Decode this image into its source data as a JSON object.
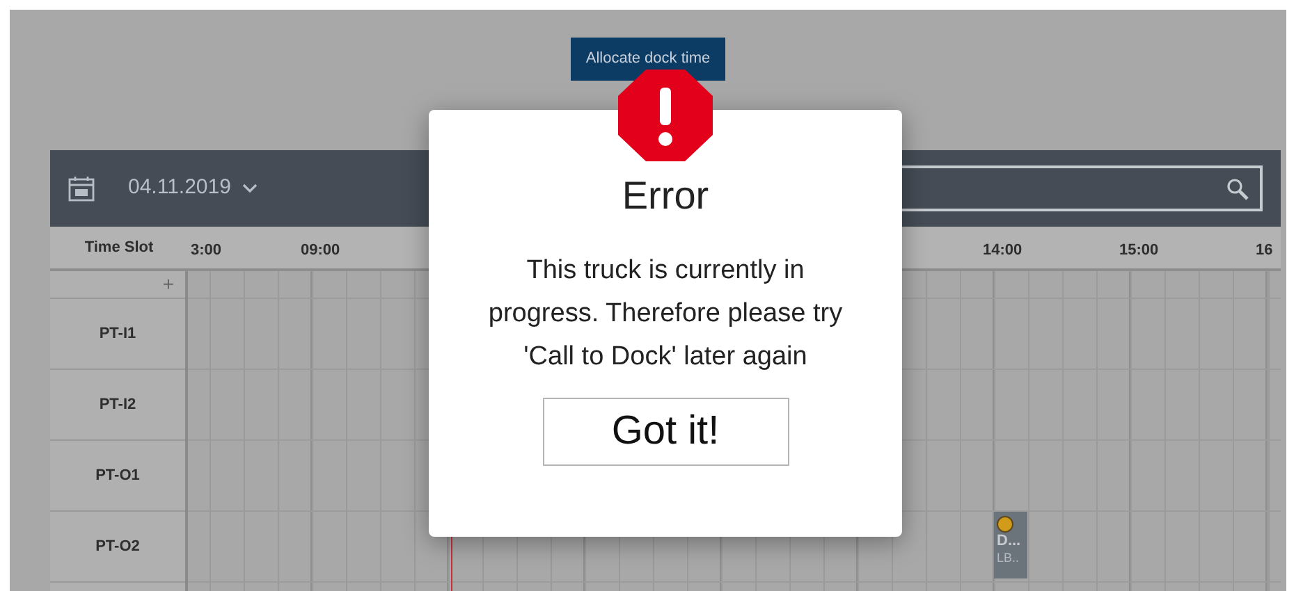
{
  "header_button": {
    "label": "Allocate dock time"
  },
  "toolbar": {
    "date": "04.11.2019"
  },
  "schedule": {
    "slot_header": "Time Slot",
    "add": "+",
    "hours": [
      "3:00",
      "09:00",
      "14:00",
      "15:00",
      "16"
    ],
    "docks": [
      {
        "name": "PT-I1"
      },
      {
        "name": "PT-I2"
      },
      {
        "name": "PT-O1"
      },
      {
        "name": "PT-O2",
        "bookings": [
          {
            "title": "D...",
            "subtitle": "LB..",
            "color": "#d39b1a"
          }
        ]
      }
    ]
  },
  "dialog": {
    "title": "Error",
    "message": "This truck is currently in progress. Therefore please try 'Call to Dock' later again",
    "button": "Got it!"
  }
}
